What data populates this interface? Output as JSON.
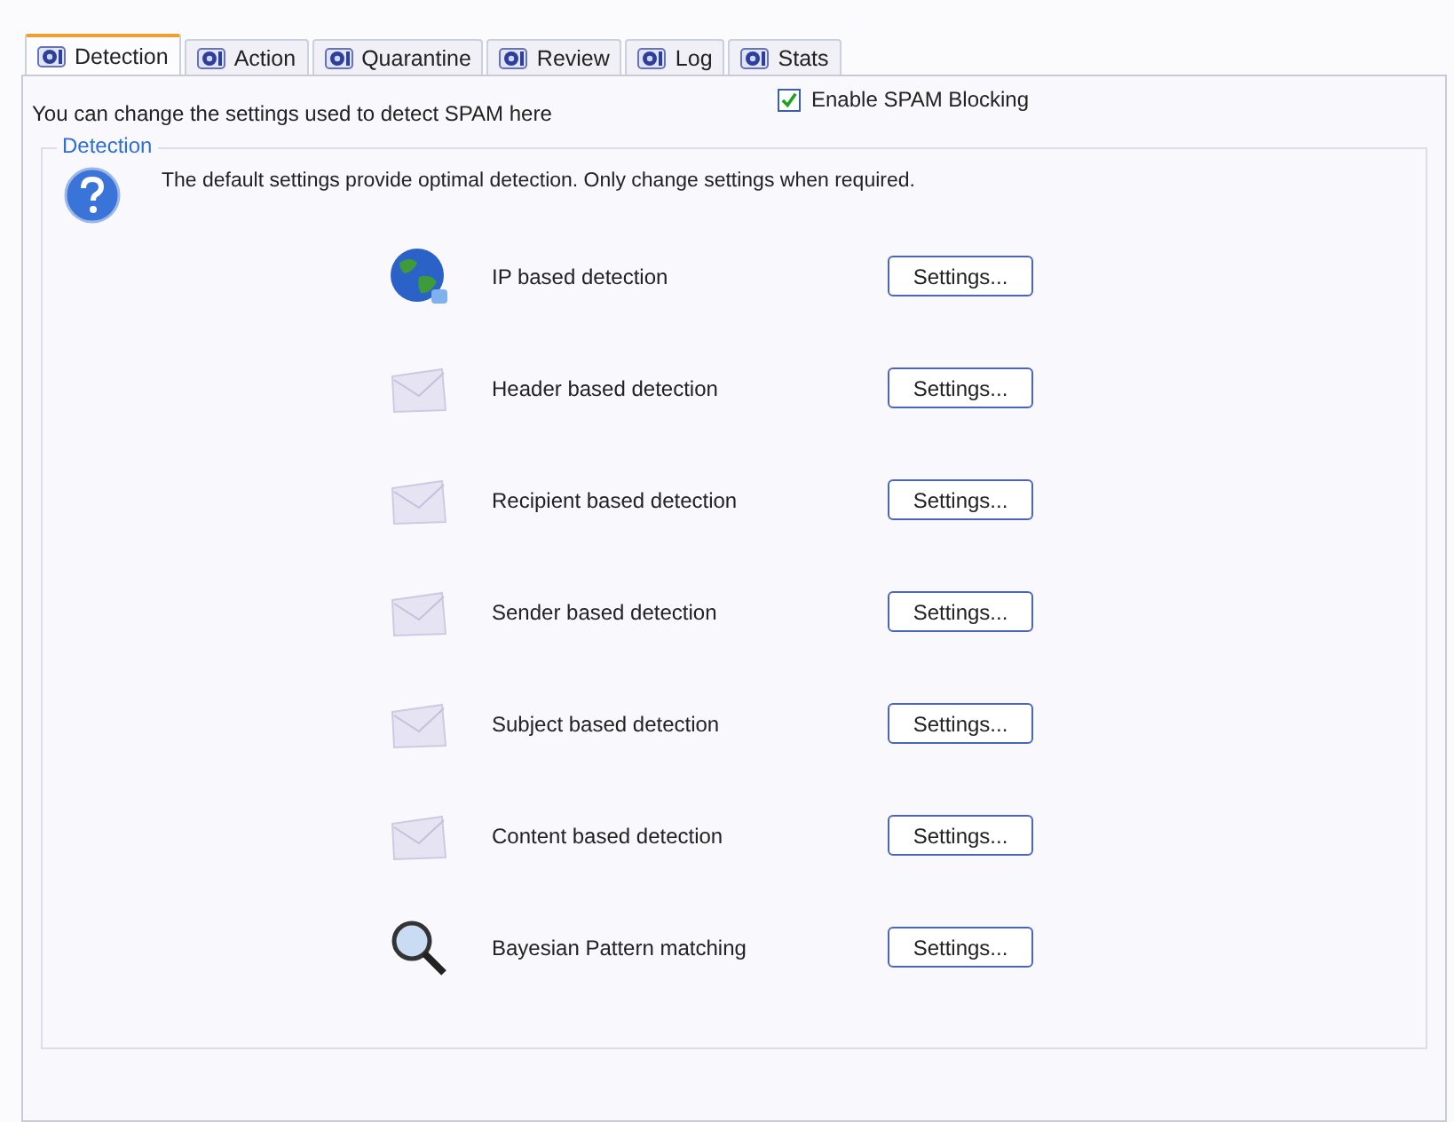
{
  "tabs": [
    {
      "label": "Detection",
      "selected": true
    },
    {
      "label": "Action",
      "selected": false
    },
    {
      "label": "Quarantine",
      "selected": false
    },
    {
      "label": "Review",
      "selected": false
    },
    {
      "label": "Log",
      "selected": false
    },
    {
      "label": "Stats",
      "selected": false
    }
  ],
  "intro": "You can change the settings used to detect SPAM here",
  "enable": {
    "label": "Enable SPAM Blocking",
    "checked": true
  },
  "group": {
    "title": "Detection",
    "note": "The default settings provide optimal detection. Only change settings when required.",
    "rows": [
      {
        "kind": "globe",
        "label": "IP based detection",
        "button": "Settings..."
      },
      {
        "kind": "envelope",
        "label": "Header based detection",
        "button": "Settings..."
      },
      {
        "kind": "envelope",
        "label": "Recipient based detection",
        "button": "Settings..."
      },
      {
        "kind": "envelope",
        "label": "Sender based detection",
        "button": "Settings..."
      },
      {
        "kind": "envelope",
        "label": "Subject based detection",
        "button": "Settings..."
      },
      {
        "kind": "envelope",
        "label": "Content based detection",
        "button": "Settings..."
      },
      {
        "kind": "magnifier",
        "label": "Bayesian Pattern matching",
        "button": "Settings..."
      }
    ]
  }
}
